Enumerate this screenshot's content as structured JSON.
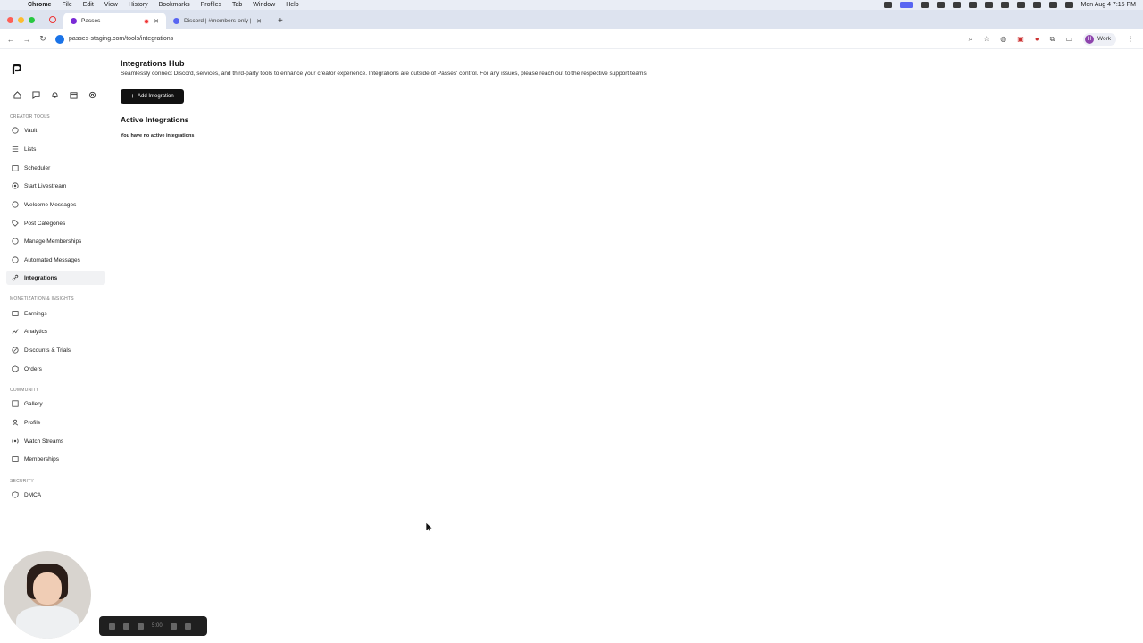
{
  "menubar": {
    "app": "Chrome",
    "items": [
      "File",
      "Edit",
      "View",
      "History",
      "Bookmarks",
      "Profiles",
      "Tab",
      "Window",
      "Help"
    ],
    "clock": "Mon Aug 4  7:15 PM"
  },
  "tabs": [
    {
      "title": "Passes",
      "active": true
    },
    {
      "title": "Discord | #members-only | D",
      "active": false
    }
  ],
  "toolbar": {
    "url": "passes-staging.com/tools/integrations",
    "profile_label": "Work",
    "profile_initial": "H"
  },
  "sidebar": {
    "sections": [
      {
        "label": "CREATOR TOOLS",
        "items": [
          "Vault",
          "Lists",
          "Scheduler",
          "Start Livestream",
          "Welcome Messages",
          "Post Categories",
          "Manage Memberships",
          "Automated Messages",
          "Integrations"
        ]
      },
      {
        "label": "MONETIZATION & INSIGHTS",
        "items": [
          "Earnings",
          "Analytics",
          "Discounts & Trials",
          "Orders"
        ]
      },
      {
        "label": "COMMUNITY",
        "items": [
          "Gallery",
          "Profile",
          "Watch Streams",
          "Memberships"
        ]
      },
      {
        "label": "SECURITY",
        "items": [
          "DMCA"
        ]
      }
    ],
    "active_item": "Integrations"
  },
  "main": {
    "title": "Integrations Hub",
    "subtitle": "Seamlessly connect Discord, services, and third-party tools to enhance your creator experience. Integrations are outside of Passes' control. For any issues, please reach out to the respective support teams.",
    "add_button_label": "Add Integration",
    "active_title": "Active Integrations",
    "empty_message": "You have no active integrations"
  },
  "recorder": {
    "timer": "5:00"
  },
  "colors": {
    "accent": "#111111",
    "active_nav_bg": "#f1f2f4"
  }
}
